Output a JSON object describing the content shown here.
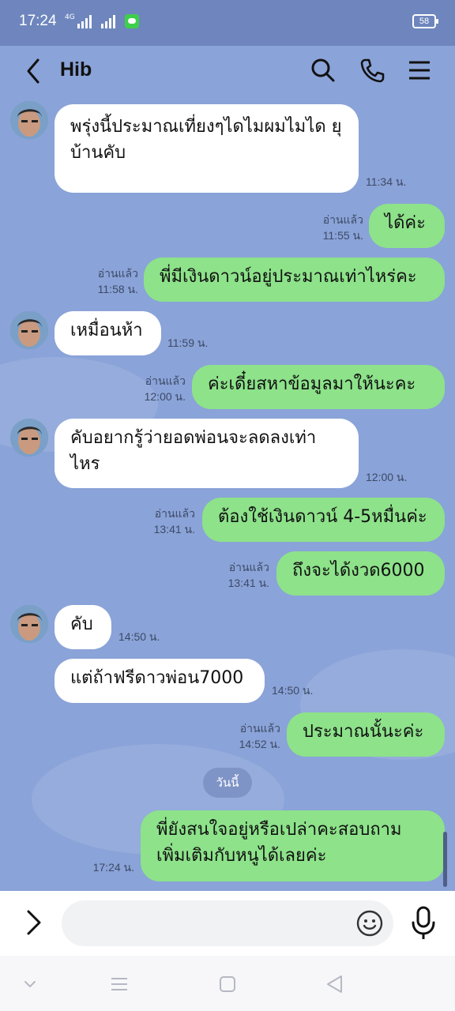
{
  "status_bar": {
    "time": "17:24",
    "network": "4G",
    "battery": "58",
    "icons": [
      "signal-icon",
      "signal-icon",
      "line-app-icon",
      "battery-icon"
    ]
  },
  "header": {
    "title": "Hib",
    "icons": [
      "back-arrow-icon",
      "search-icon",
      "phone-icon",
      "menu-icon"
    ]
  },
  "messages": [
    {
      "direction": "in",
      "text": "พรุ่งนี้ประมาณเที่ยงๆไดไมผมไมได ยุบ้านคับ",
      "time": "11:34 น.",
      "read": ""
    },
    {
      "direction": "out",
      "text": "ได้ค่ะ",
      "time": "11:55 น.",
      "read": "อ่านแล้ว"
    },
    {
      "direction": "out",
      "text": "พี่มีเงินดาวน์อยู่ประมาณเท่าไหร่คะ",
      "time": "11:58 น.",
      "read": "อ่านแล้ว"
    },
    {
      "direction": "in",
      "text": "เหมื่อนห้า",
      "time": "11:59 น.",
      "read": ""
    },
    {
      "direction": "out",
      "text": "ค่ะเดี๋ยสหาข้อมูลมาให้นะคะ",
      "time": "12:00 น.",
      "read": "อ่านแล้ว"
    },
    {
      "direction": "in",
      "text": "คับอยากรู้ว่ายอดพ่อนจะลดลงเท่าไหร",
      "time": "12:00 น.",
      "read": ""
    },
    {
      "direction": "out",
      "text": "ต้องใช้เงินดาวน์ 4-5หมื่นค่ะ",
      "time": "13:41 น.",
      "read": "อ่านแล้ว"
    },
    {
      "direction": "out",
      "text": "ถึงจะได้งวด6000",
      "time": "13:41 น.",
      "read": "อ่านแล้ว"
    },
    {
      "direction": "in",
      "text": "คับ",
      "time": "14:50 น.",
      "read": ""
    },
    {
      "direction": "in",
      "text": "แต่ถ้าฟรีดาวพ่อน7000",
      "time": "14:50 น.",
      "read": ""
    },
    {
      "direction": "out",
      "text": "ประมาณนั้นะค่ะ",
      "time": "14:52 น.",
      "read": "อ่านแล้ว"
    },
    {
      "direction": "out",
      "text": "พี่ยังสนใจอยู่หรือเปล่าคะสอบถามเพิ่มเติมกับหนูได้เลยค่ะ",
      "time": "17:24 น.",
      "read": ""
    }
  ],
  "date_separator": "วันนี้",
  "input": {
    "placeholder": "",
    "value": "",
    "icons": [
      "chevron-right-icon",
      "emoji-icon",
      "microphone-icon"
    ]
  },
  "nav_bar": {
    "icons": [
      "chevron-down-icon",
      "menu-lines-icon",
      "home-square-icon",
      "back-triangle-icon"
    ]
  },
  "colors": {
    "chat_background": "#8aa3d8",
    "status_bar": "#6e86bd",
    "outgoing_bubble": "#8de28a",
    "incoming_bubble": "#ffffff"
  }
}
